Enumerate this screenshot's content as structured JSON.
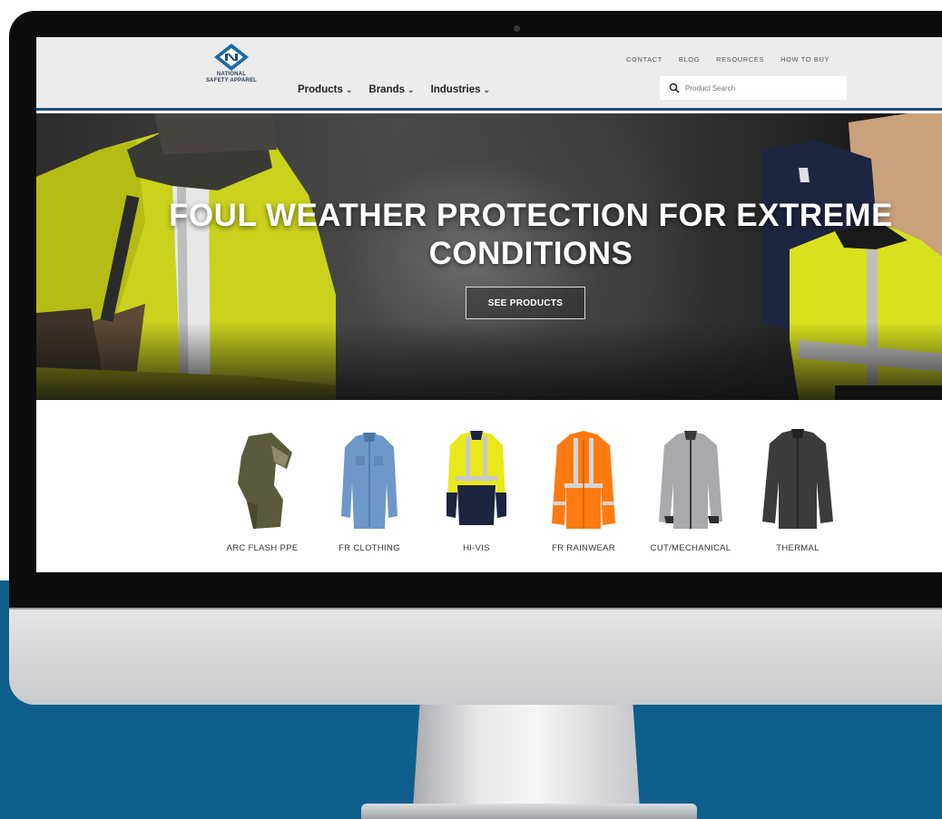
{
  "site": {
    "logo_text_line1": "NATIONAL",
    "logo_text_line2": "SAFETY APPAREL",
    "main_nav": [
      {
        "label": "Products"
      },
      {
        "label": "Brands"
      },
      {
        "label": "Industries"
      }
    ],
    "util_nav": [
      "CONTACT",
      "BLOG",
      "RESOURCES",
      "HOW TO BUY"
    ],
    "search": {
      "placeholder": "Product Search"
    }
  },
  "hero": {
    "title_line1": "FOUL WEATHER PROTECTION FOR EXTREME",
    "title_line2": "CONDITIONS",
    "button_label": "SEE PRODUCTS"
  },
  "categories": [
    {
      "label": "ARC FLASH PPE",
      "color": "#5b5a3c"
    },
    {
      "label": "FR CLOTHING",
      "color": "#6d98c9"
    },
    {
      "label": "HI-VIS",
      "color": "#e8e81b"
    },
    {
      "label": "FR RAINWEAR",
      "color": "#ff7a10"
    },
    {
      "label": "CUT/MECHANICAL",
      "color": "#a8a9ad"
    },
    {
      "label": "THERMAL",
      "color": "#3b3b3b"
    }
  ],
  "colors": {
    "header_bg": "#ececec",
    "header_border": "#1f4d7a",
    "backdrop_blue": "#0f5f8e",
    "hivis_yellow": "#d9e21a"
  }
}
